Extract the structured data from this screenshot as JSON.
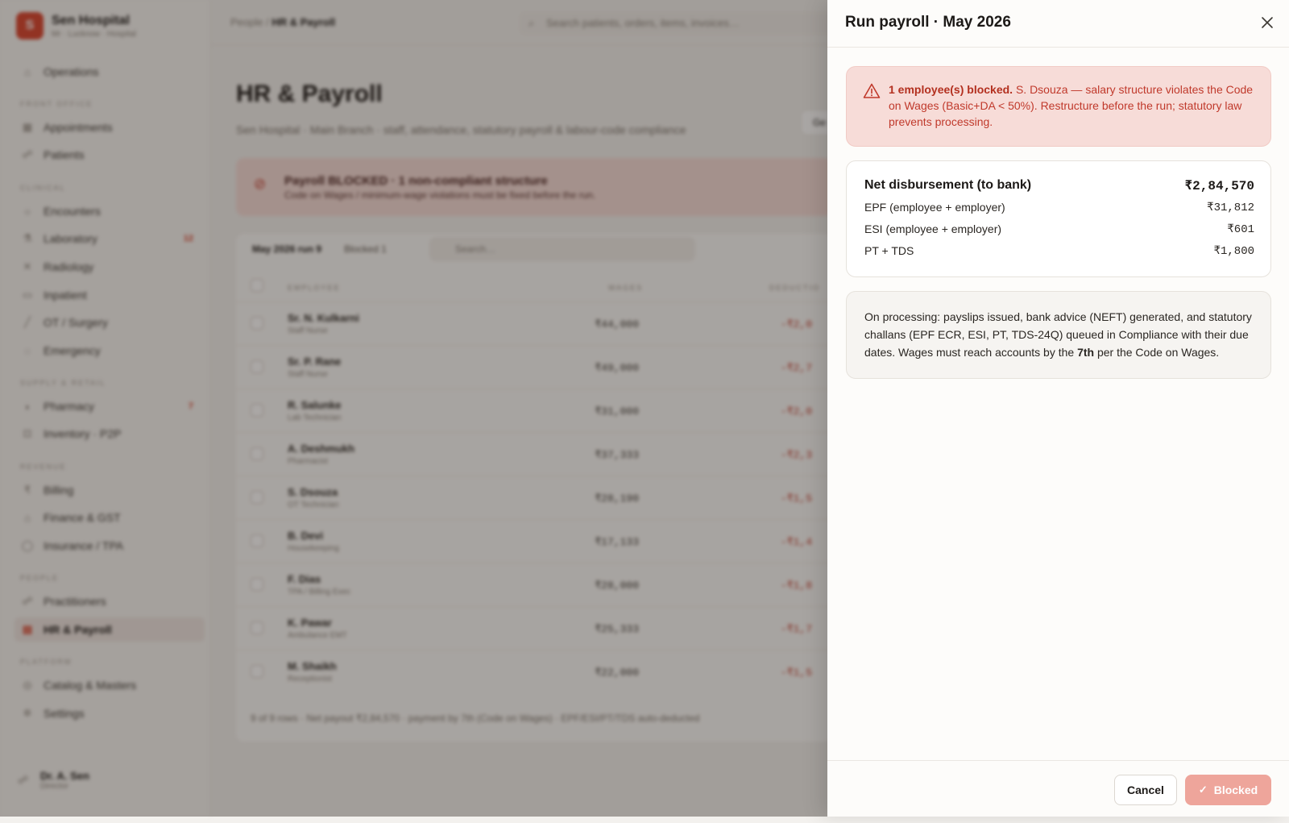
{
  "app": {
    "brand_name": "Sen Hospital",
    "brand_sub": "Mr · Lucknow · Hospital",
    "brand_initial": "S",
    "breadcrumb_parent": "People / ",
    "breadcrumb_current": "HR & Payroll",
    "search_placeholder": "Search patients, orders, items, invoices…"
  },
  "sidebar": {
    "items": [
      {
        "label": "Operations",
        "icon": "home-icon"
      },
      {
        "label": "Appointments",
        "icon": "calendar-icon"
      },
      {
        "label": "Patients",
        "icon": "patients-icon"
      },
      {
        "label": "Encounters",
        "icon": "encounter-icon"
      },
      {
        "label": "Laboratory",
        "icon": "flask-icon",
        "badge": "12"
      },
      {
        "label": "Radiology",
        "icon": "radiology-icon"
      },
      {
        "label": "Inpatient",
        "icon": "bed-icon"
      },
      {
        "label": "OT / Surgery",
        "icon": "scalpel-icon"
      },
      {
        "label": "Emergency",
        "icon": "emergency-icon"
      },
      {
        "label": "Pharmacy",
        "icon": "pill-icon",
        "badge": "7"
      },
      {
        "label": "Inventory · P2P",
        "icon": "box-icon"
      },
      {
        "label": "Billing",
        "icon": "rupee-icon"
      },
      {
        "label": "Finance & GST",
        "icon": "bank-icon"
      },
      {
        "label": "Insurance / TPA",
        "icon": "shield-icon"
      },
      {
        "label": "Practitioners",
        "icon": "stethoscope-icon"
      },
      {
        "label": "HR & Payroll",
        "icon": "payroll-icon"
      },
      {
        "label": "Catalog & Masters",
        "icon": "catalog-icon"
      },
      {
        "label": "Settings",
        "icon": "gear-icon"
      }
    ],
    "groups": [
      "Front office",
      "Clinical",
      "Supply & retail",
      "Revenue",
      "People",
      "Platform"
    ],
    "user_name": "Dr. A. Sen",
    "user_role": "Director"
  },
  "page": {
    "title": "HR & Payroll",
    "subtitle": "Sen Hospital · Main Branch · staff, attendance, statutory payroll & labour-code compliance",
    "alert_title": "Payroll BLOCKED · 1 non-compliant structure",
    "alert_text": "Code on Wages / minimum-wage violations must be fixed before the run.",
    "header_button": "Ge",
    "tabs": [
      {
        "label": "May 2026 run",
        "count": "9"
      },
      {
        "label": "Blocked",
        "count": "1"
      }
    ],
    "table_search_placeholder": "Search…",
    "col_employee": "Employee",
    "col_wages": "Wages",
    "col_deductions": "Deductio",
    "rows": [
      {
        "name": "Sr. N. Kulkarni",
        "role": "Staff Nurse",
        "wages": "₹44,000",
        "ded": "-₹2,0"
      },
      {
        "name": "Sr. P. Rane",
        "role": "Staff Nurse",
        "wages": "₹49,000",
        "ded": "-₹2,7"
      },
      {
        "name": "R. Salunke",
        "role": "Lab Technician",
        "wages": "₹31,000",
        "ded": "-₹2,0"
      },
      {
        "name": "A. Deshmukh",
        "role": "Pharmacist",
        "wages": "₹37,333",
        "ded": "-₹2,3"
      },
      {
        "name": "S. Dsouza",
        "role": "OT Technician",
        "wages": "₹28,190",
        "ded": "-₹1,5"
      },
      {
        "name": "B. Devi",
        "role": "Housekeeping",
        "wages": "₹17,133",
        "ded": "-₹1,4"
      },
      {
        "name": "F. Dias",
        "role": "TPA / Billing Exec",
        "wages": "₹28,000",
        "ded": "-₹1,8"
      },
      {
        "name": "K. Pawar",
        "role": "Ambulance EMT",
        "wages": "₹25,333",
        "ded": "-₹1,7"
      },
      {
        "name": "M. Shaikh",
        "role": "Receptionist",
        "wages": "₹22,000",
        "ded": "-₹1,5"
      }
    ],
    "footer": "9 of 9 rows · Net payout ₹2,84,570 · payment by 7th (Code on Wages) · EPF/ESI/PT/TDS auto-deducted"
  },
  "drawer": {
    "title": "Run payroll · May 2026",
    "warning_bold": "1 employee(s) blocked.",
    "warning_text": " S. Dsouza — salary structure violates the Code on Wages (Basic+DA < 50%). Restructure before the run; statutory law prevents processing.",
    "totals": [
      {
        "label": "Net disbursement (to bank)",
        "value": "₹2,84,570"
      },
      {
        "label": "EPF (employee + employer)",
        "value": "₹31,812"
      },
      {
        "label": "ESI (employee + employer)",
        "value": "₹601"
      },
      {
        "label": "PT + TDS",
        "value": "₹1,800"
      }
    ],
    "note_pre": "On processing: payslips issued, bank advice (NEFT) generated, and statutory challans (EPF ECR, ESI, PT, TDS-24Q) queued in Compliance with their due dates. Wages must reach accounts by the ",
    "note_bold": "7th",
    "note_post": " per the Code on Wages.",
    "cancel_label": "Cancel",
    "blocked_label": "Blocked",
    "colors": {
      "warning_text": "#c0392b",
      "warning_bg": "#f7dcd8",
      "blocked_button": "#eea59b"
    }
  }
}
